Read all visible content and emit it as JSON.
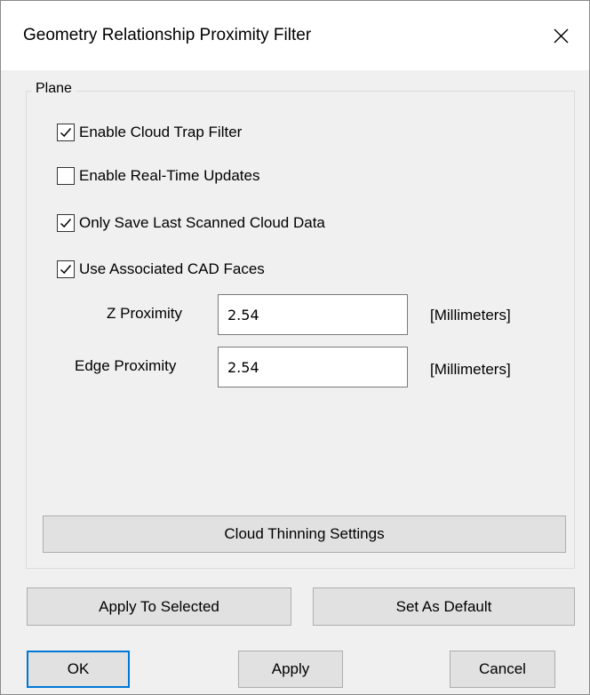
{
  "dialog": {
    "title": "Geometry Relationship Proximity Filter",
    "close_glyph": "close-icon"
  },
  "plane_group": {
    "label": "Plane",
    "checkboxes": [
      {
        "label": "Enable Cloud Trap Filter",
        "checked": true
      },
      {
        "label": "Enable Real-Time Updates",
        "checked": false
      },
      {
        "label": "Only Save Last Scanned Cloud Data",
        "checked": true
      },
      {
        "label": "Use Associated CAD Faces",
        "checked": true
      }
    ],
    "z_proximity": {
      "label": "Z Proximity",
      "value": "2.54",
      "unit": "[Millimeters]"
    },
    "edge_proximity": {
      "label": "Edge Proximity",
      "value": "2.54",
      "unit": "[Millimeters]"
    },
    "thinning_button": "Cloud Thinning Settings"
  },
  "actions": {
    "apply_to_selected": "Apply To Selected",
    "set_as_default": "Set As Default"
  },
  "footer": {
    "ok": "OK",
    "apply": "Apply",
    "cancel": "Cancel"
  },
  "colors": {
    "dialog_bg": "#f0f0f0",
    "title_bg": "#ffffff",
    "button_bg": "#e1e1e1",
    "focus_border": "#0078d7"
  }
}
